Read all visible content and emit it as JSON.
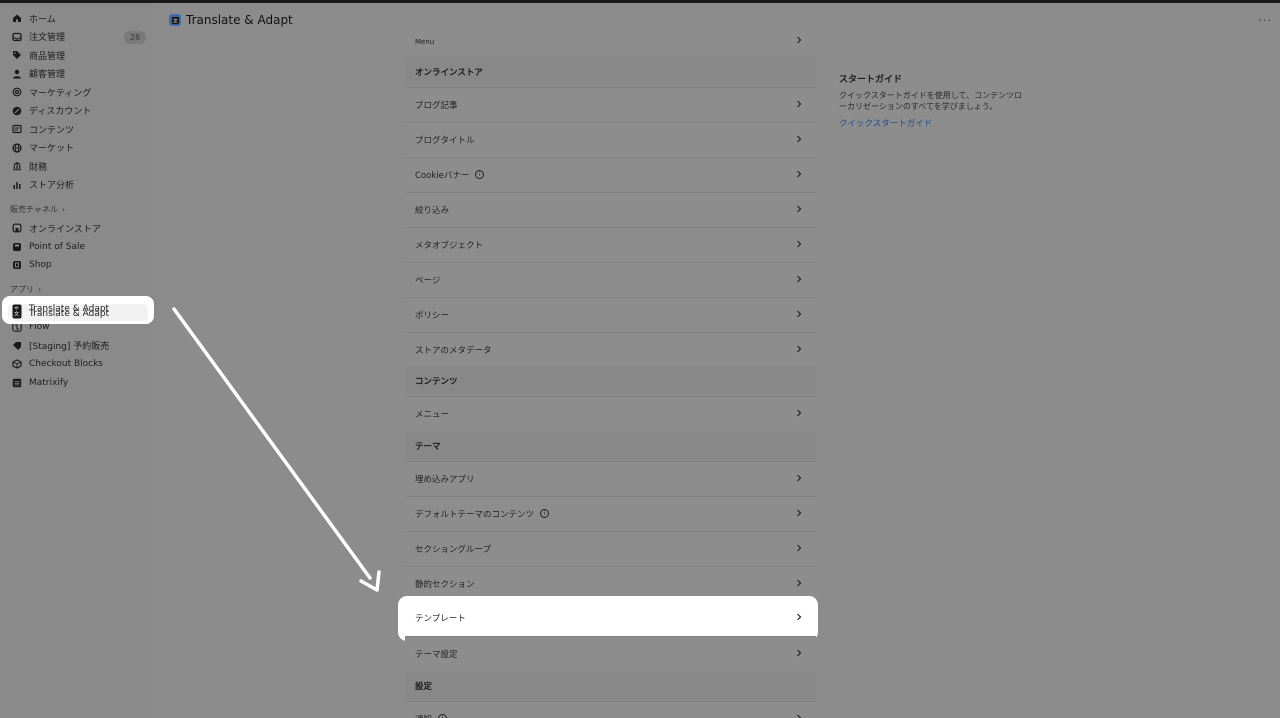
{
  "sidebar": {
    "items": [
      {
        "label": "ホーム",
        "icon": "home-icon"
      },
      {
        "label": "注文管理",
        "icon": "inbox-icon",
        "badge": "28"
      },
      {
        "label": "商品管理",
        "icon": "tag-icon"
      },
      {
        "label": "顧客管理",
        "icon": "person-icon"
      },
      {
        "label": "マーケティング",
        "icon": "target-icon"
      },
      {
        "label": "ディスカウント",
        "icon": "discount-icon"
      },
      {
        "label": "コンテンツ",
        "icon": "content-icon"
      },
      {
        "label": "マーケット",
        "icon": "globe-icon"
      },
      {
        "label": "財務",
        "icon": "bank-icon"
      },
      {
        "label": "ストア分析",
        "icon": "chart-icon"
      }
    ],
    "sales_channels_label": "販売チャネル",
    "sales_channels": [
      {
        "label": "オンラインストア",
        "icon": "store-icon"
      },
      {
        "label": "Point of Sale",
        "icon": "pos-icon"
      },
      {
        "label": "Shop",
        "icon": "shop-icon"
      }
    ],
    "apps_label": "アプリ",
    "apps": [
      {
        "label": "Translate & Adapt",
        "icon": "translate-icon"
      },
      {
        "label": "Flow",
        "icon": "flow-icon"
      },
      {
        "label": "[Staging] 予約販売",
        "icon": "preorder-icon"
      },
      {
        "label": "Checkout Blocks",
        "icon": "box-icon"
      },
      {
        "label": "Matrixify",
        "icon": "grid-icon"
      }
    ]
  },
  "header": {
    "title": "Translate & Adapt"
  },
  "main": {
    "top_row": "Menu",
    "groups": [
      {
        "title": "オンラインストア",
        "rows": [
          "ブログ記事",
          "ブログタイトル",
          "Cookieバナー",
          "絞り込み",
          "メタオブジェクト",
          "ページ",
          "ポリシー",
          "ストアのメタデータ"
        ]
      },
      {
        "title": "コンテンツ",
        "rows": [
          "メニュー"
        ]
      },
      {
        "title": "テーマ",
        "rows": [
          "埋め込みアプリ",
          "デフォルトテーマのコンテンツ",
          "セクショングループ",
          "静的セクション",
          "テンプレート",
          "テーマ設定"
        ]
      },
      {
        "title": "設定",
        "rows": [
          "通知"
        ]
      }
    ]
  },
  "guide": {
    "title": "スタートガイド",
    "description": "クイックスタートガイドを使用して、コンテンツローカリゼーションのすべてを学びましょう。",
    "link": "クイックスタートガイド"
  }
}
